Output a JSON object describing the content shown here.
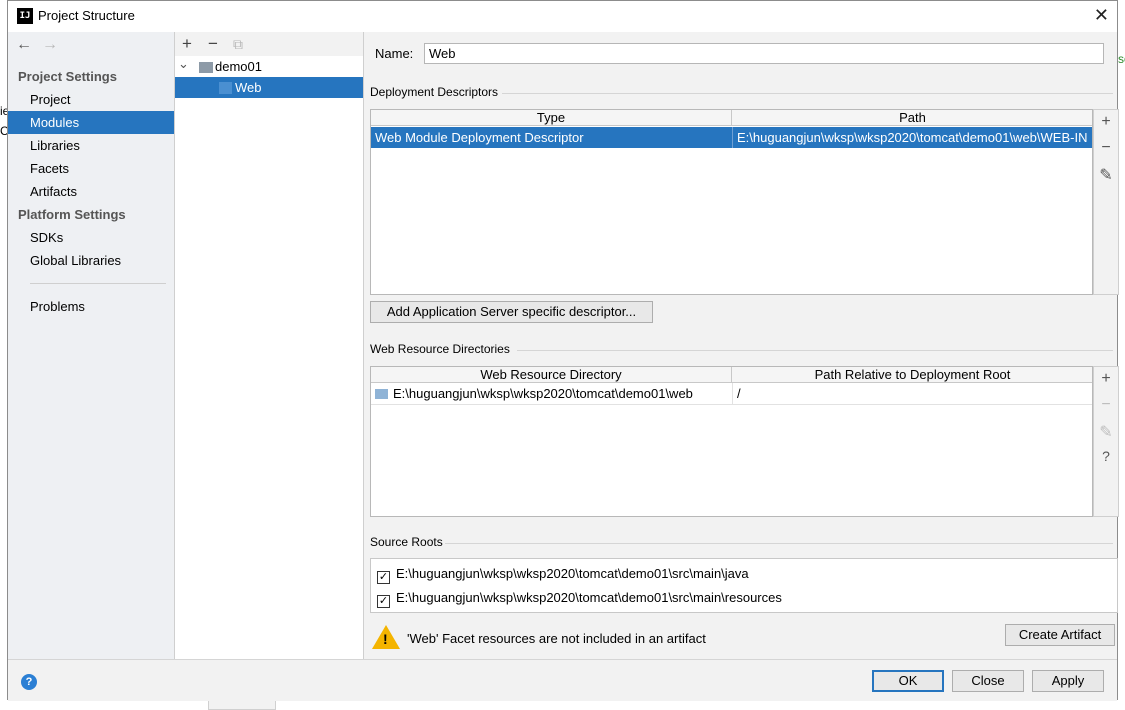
{
  "window": {
    "title": "Project Structure",
    "icon_text": "IJ",
    "close_icon": "close-icon"
  },
  "background": {
    "fragments": [
      "ie",
      "C",
      "so"
    ]
  },
  "left_pane": {
    "back_icon": "←",
    "forward_icon": "→",
    "project_settings_title": "Project Settings",
    "project_settings_items": [
      "Project",
      "Modules",
      "Libraries",
      "Facets",
      "Artifacts"
    ],
    "selected_item": "Modules",
    "platform_settings_title": "Platform Settings",
    "platform_settings_items": [
      "SDKs",
      "Global Libraries"
    ],
    "problems_label": "Problems"
  },
  "tree": {
    "toolbar": {
      "add": "+",
      "remove": "−",
      "copy": "⧉"
    },
    "root": {
      "label": "demo01",
      "expander": "⌄"
    },
    "child": {
      "label": "Web"
    }
  },
  "facet": {
    "name_label": "Name:",
    "name_value": "Web",
    "deployment_descriptors": {
      "title": "Deployment Descriptors",
      "columns": [
        "Type",
        "Path"
      ],
      "rows": [
        {
          "type": "Web Module Deployment Descriptor",
          "path": "E:\\huguangjun\\wksp\\wksp2020\\tomcat\\demo01\\web\\WEB-IN"
        }
      ],
      "tools": {
        "add": "+",
        "remove": "−",
        "edit": "✎"
      },
      "add_descriptor_button": "Add Application Server specific descriptor..."
    },
    "web_resource_directories": {
      "title": "Web Resource Directories",
      "columns": [
        "Web Resource Directory",
        "Path Relative to Deployment Root"
      ],
      "rows": [
        {
          "directory": "E:\\huguangjun\\wksp\\wksp2020\\tomcat\\demo01\\web",
          "relative_path": "/"
        }
      ],
      "tools": {
        "add": "+",
        "remove": "−",
        "edit": "✎",
        "help": "?"
      }
    },
    "source_roots": {
      "title": "Source Roots",
      "items": [
        {
          "path": "E:\\huguangjun\\wksp\\wksp2020\\tomcat\\demo01\\src\\main\\java",
          "checked": true
        },
        {
          "path": "E:\\huguangjun\\wksp\\wksp2020\\tomcat\\demo01\\src\\main\\resources",
          "checked": true
        }
      ]
    },
    "warning": {
      "icon": "warning-icon",
      "text": "'Web' Facet resources are not included in an artifact"
    },
    "create_artifact_button": "Create Artifact"
  },
  "footer": {
    "help_icon": "?",
    "ok_label": "OK",
    "close_label": "Close",
    "apply_label": "Apply"
  },
  "colors": {
    "selection": "#2675bf",
    "dialog_bg": "#f2f2f2",
    "warning": "#f4b400"
  }
}
